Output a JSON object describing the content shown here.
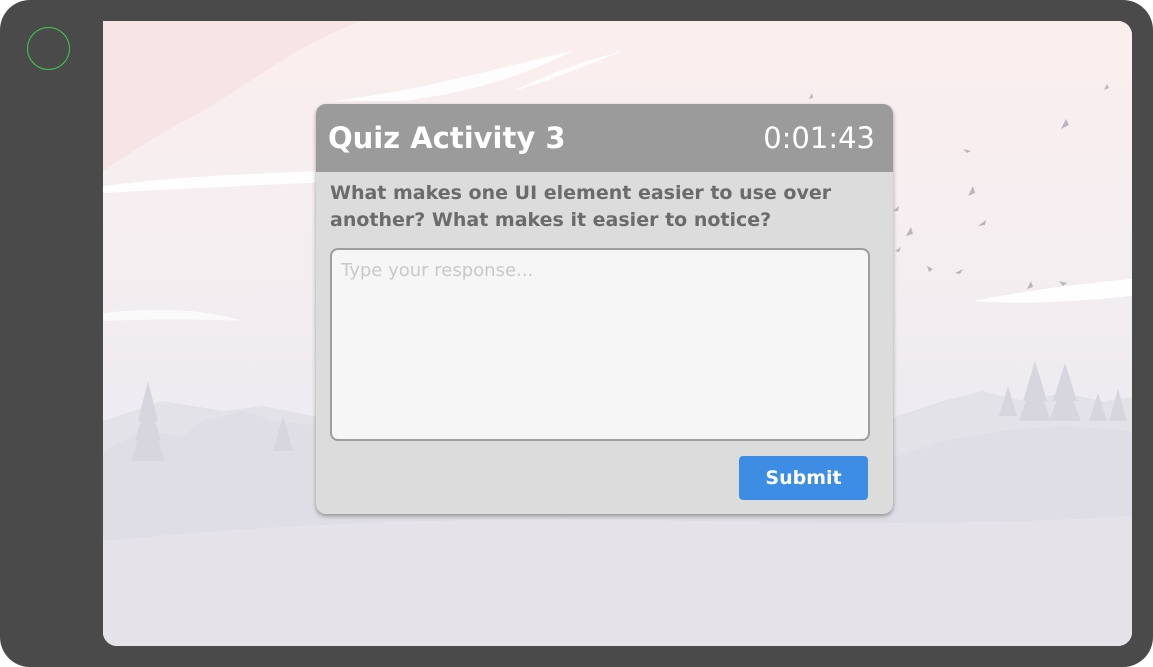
{
  "quiz": {
    "title": "Quiz Activity 3",
    "timer": "0:01:43",
    "question": "What makes one UI element easier to use over another? What makes it easier to notice?",
    "response_placeholder": "Type your response...",
    "response_value": "",
    "submit_label": "Submit"
  },
  "colors": {
    "frame": "#4a4a4a",
    "home_button_ring": "#3fcf49",
    "dialog_header": "#9b9b9b",
    "dialog_body": "#dcdcdc",
    "submit_button": "#3c8de3"
  }
}
